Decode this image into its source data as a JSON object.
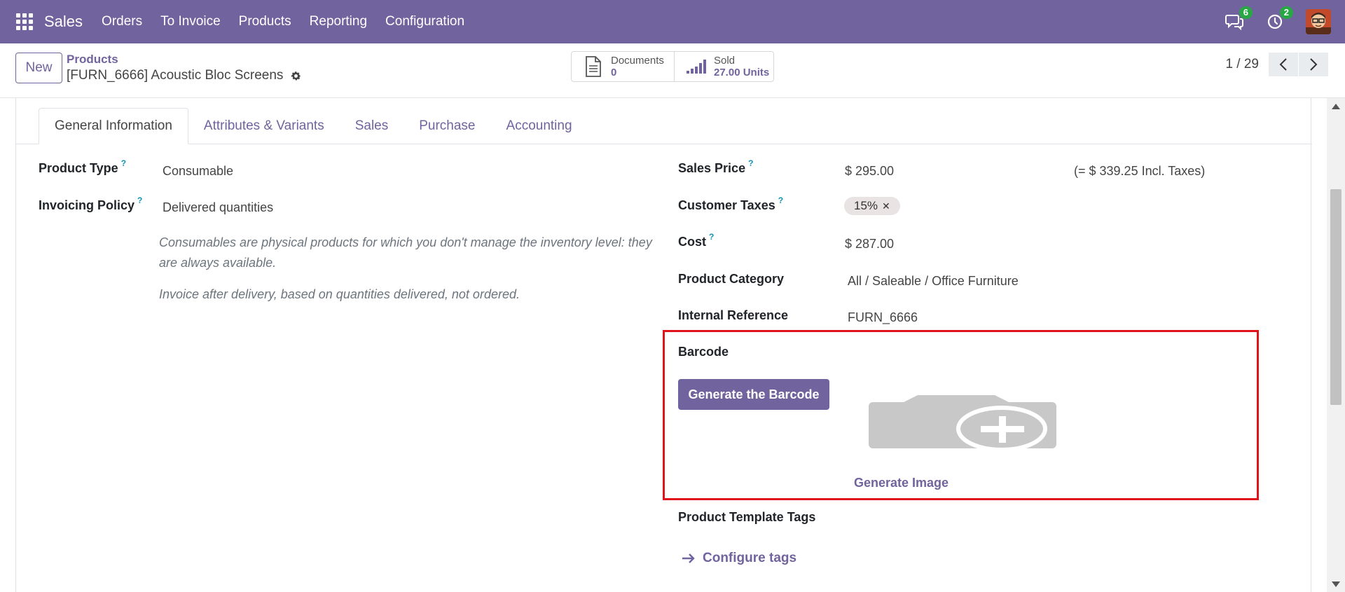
{
  "navbar": {
    "app_name": "Sales",
    "menu": [
      "Orders",
      "To Invoice",
      "Products",
      "Reporting",
      "Configuration"
    ],
    "messages_count": "6",
    "activities_count": "2",
    "color": "#71639e"
  },
  "control": {
    "new_label": "New",
    "breadcrumb_parent": "Products",
    "breadcrumb_current": "[FURN_6666] Acoustic Bloc Screens",
    "documents_label": "Documents",
    "documents_value": "0",
    "sold_label": "Sold",
    "sold_value": "27.00 Units",
    "pager_value": "1 / 29"
  },
  "tabs": [
    "General Information",
    "Attributes & Variants",
    "Sales",
    "Purchase",
    "Accounting"
  ],
  "active_tab": "General Information",
  "left_fields": {
    "product_type_label": "Product Type",
    "product_type_value": "Consumable",
    "invoicing_policy_label": "Invoicing Policy",
    "invoicing_policy_value": "Delivered quantities",
    "note_consumable": "Consumables are physical products for which you don't manage the inventory level: they are always available.",
    "note_invoice": "Invoice after delivery, based on quantities delivered, not ordered."
  },
  "right_fields": {
    "sales_price_label": "Sales Price",
    "sales_price_value": "$ 295.00",
    "sales_price_incl": "(= $ 339.25 Incl. Taxes)",
    "customer_taxes_label": "Customer Taxes",
    "customer_taxes_tag": "15%",
    "cost_label": "Cost",
    "cost_value": "$ 287.00",
    "category_label": "Product Category",
    "category_value": "All / Saleable / Office Furniture",
    "internal_ref_label": "Internal Reference",
    "internal_ref_value": "FURN_6666",
    "barcode_label": "Barcode",
    "generate_barcode_label": "Generate the Barcode",
    "generate_image_label": "Generate Image",
    "template_tags_label": "Product Template Tags",
    "configure_tags_label": "Configure tags"
  },
  "icons": {
    "apps": "apps-grid-icon",
    "messages": "chat-icon",
    "activities": "clock-icon",
    "gear": "gear-icon",
    "documents": "document-icon",
    "sold": "bar-chart-icon",
    "prev": "chevron-left-icon",
    "next": "chevron-right-icon",
    "camera_placeholder": "camera-plus-icon",
    "arrow": "arrow-right-icon"
  },
  "highlight_color": "#e0131a"
}
